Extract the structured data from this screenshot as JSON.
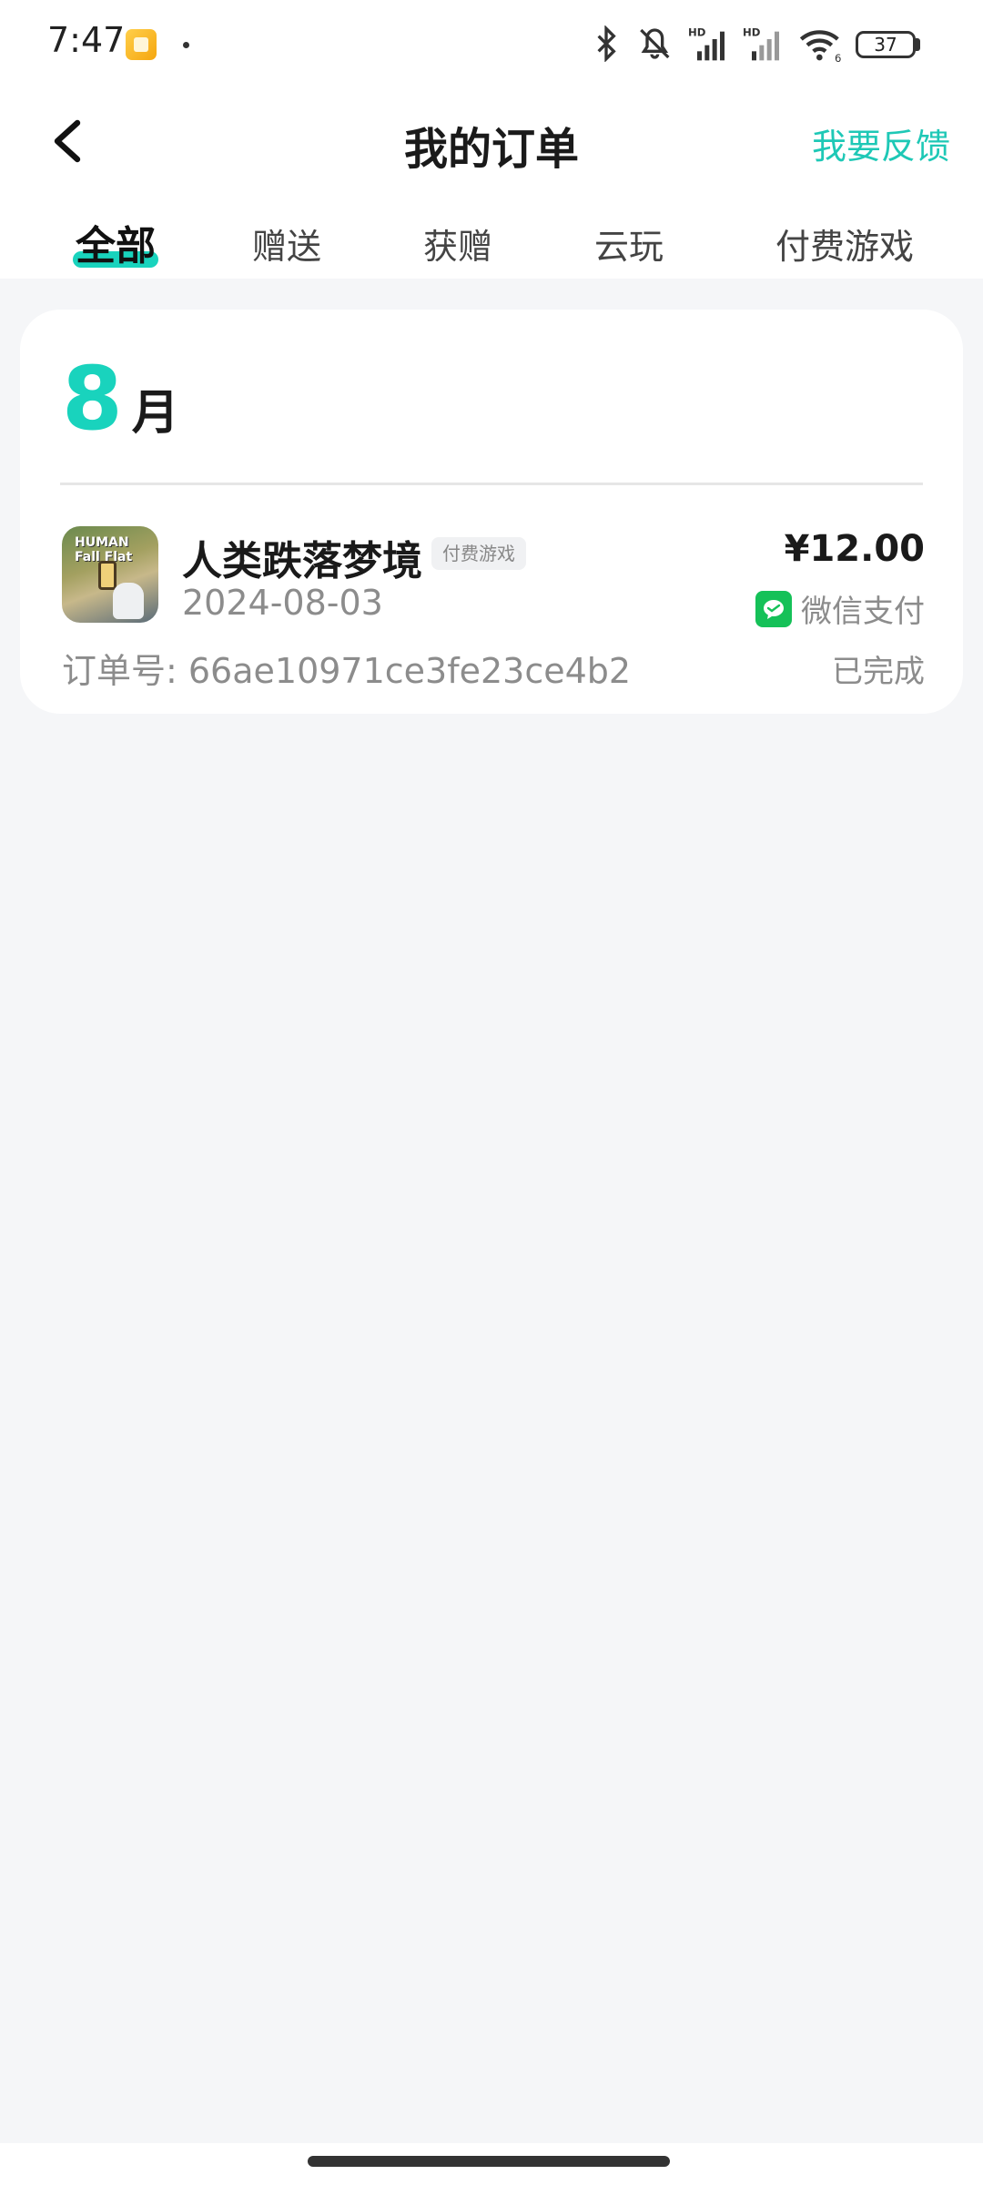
{
  "status_bar": {
    "time": "7:47",
    "battery": "37",
    "icons": [
      "notification-app-icon",
      "bluetooth-icon",
      "mute-icon",
      "signal-hd-icon",
      "signal-hd-icon",
      "wifi-icon",
      "battery-icon"
    ],
    "signal_hd_1": "HD",
    "signal_hd_2": "HD",
    "wifi_label": "6"
  },
  "header": {
    "title": "我的订单",
    "feedback": "我要反馈",
    "back_icon": "chevron-left-icon"
  },
  "tabs": [
    {
      "label": "全部",
      "active": true
    },
    {
      "label": "赠送",
      "active": false
    },
    {
      "label": "获赠",
      "active": false
    },
    {
      "label": "云玩",
      "active": false
    },
    {
      "label": "付费游戏",
      "active": false
    }
  ],
  "orders": {
    "month_number": "8",
    "month_unit": "月",
    "items": [
      {
        "game_name": "人类跌落梦境",
        "type_badge": "付费游戏",
        "date": "2024-08-03",
        "order_label": "订单号: 66ae10971ce3fe23ce4b2",
        "price": "¥12.00",
        "pay_method": "微信支付",
        "status": "已完成",
        "icon_logo": "HUMAN Fall Flat"
      }
    ]
  },
  "colors": {
    "accent": "#19d3bd",
    "wechat": "#15c158",
    "background": "#f5f6f8"
  }
}
